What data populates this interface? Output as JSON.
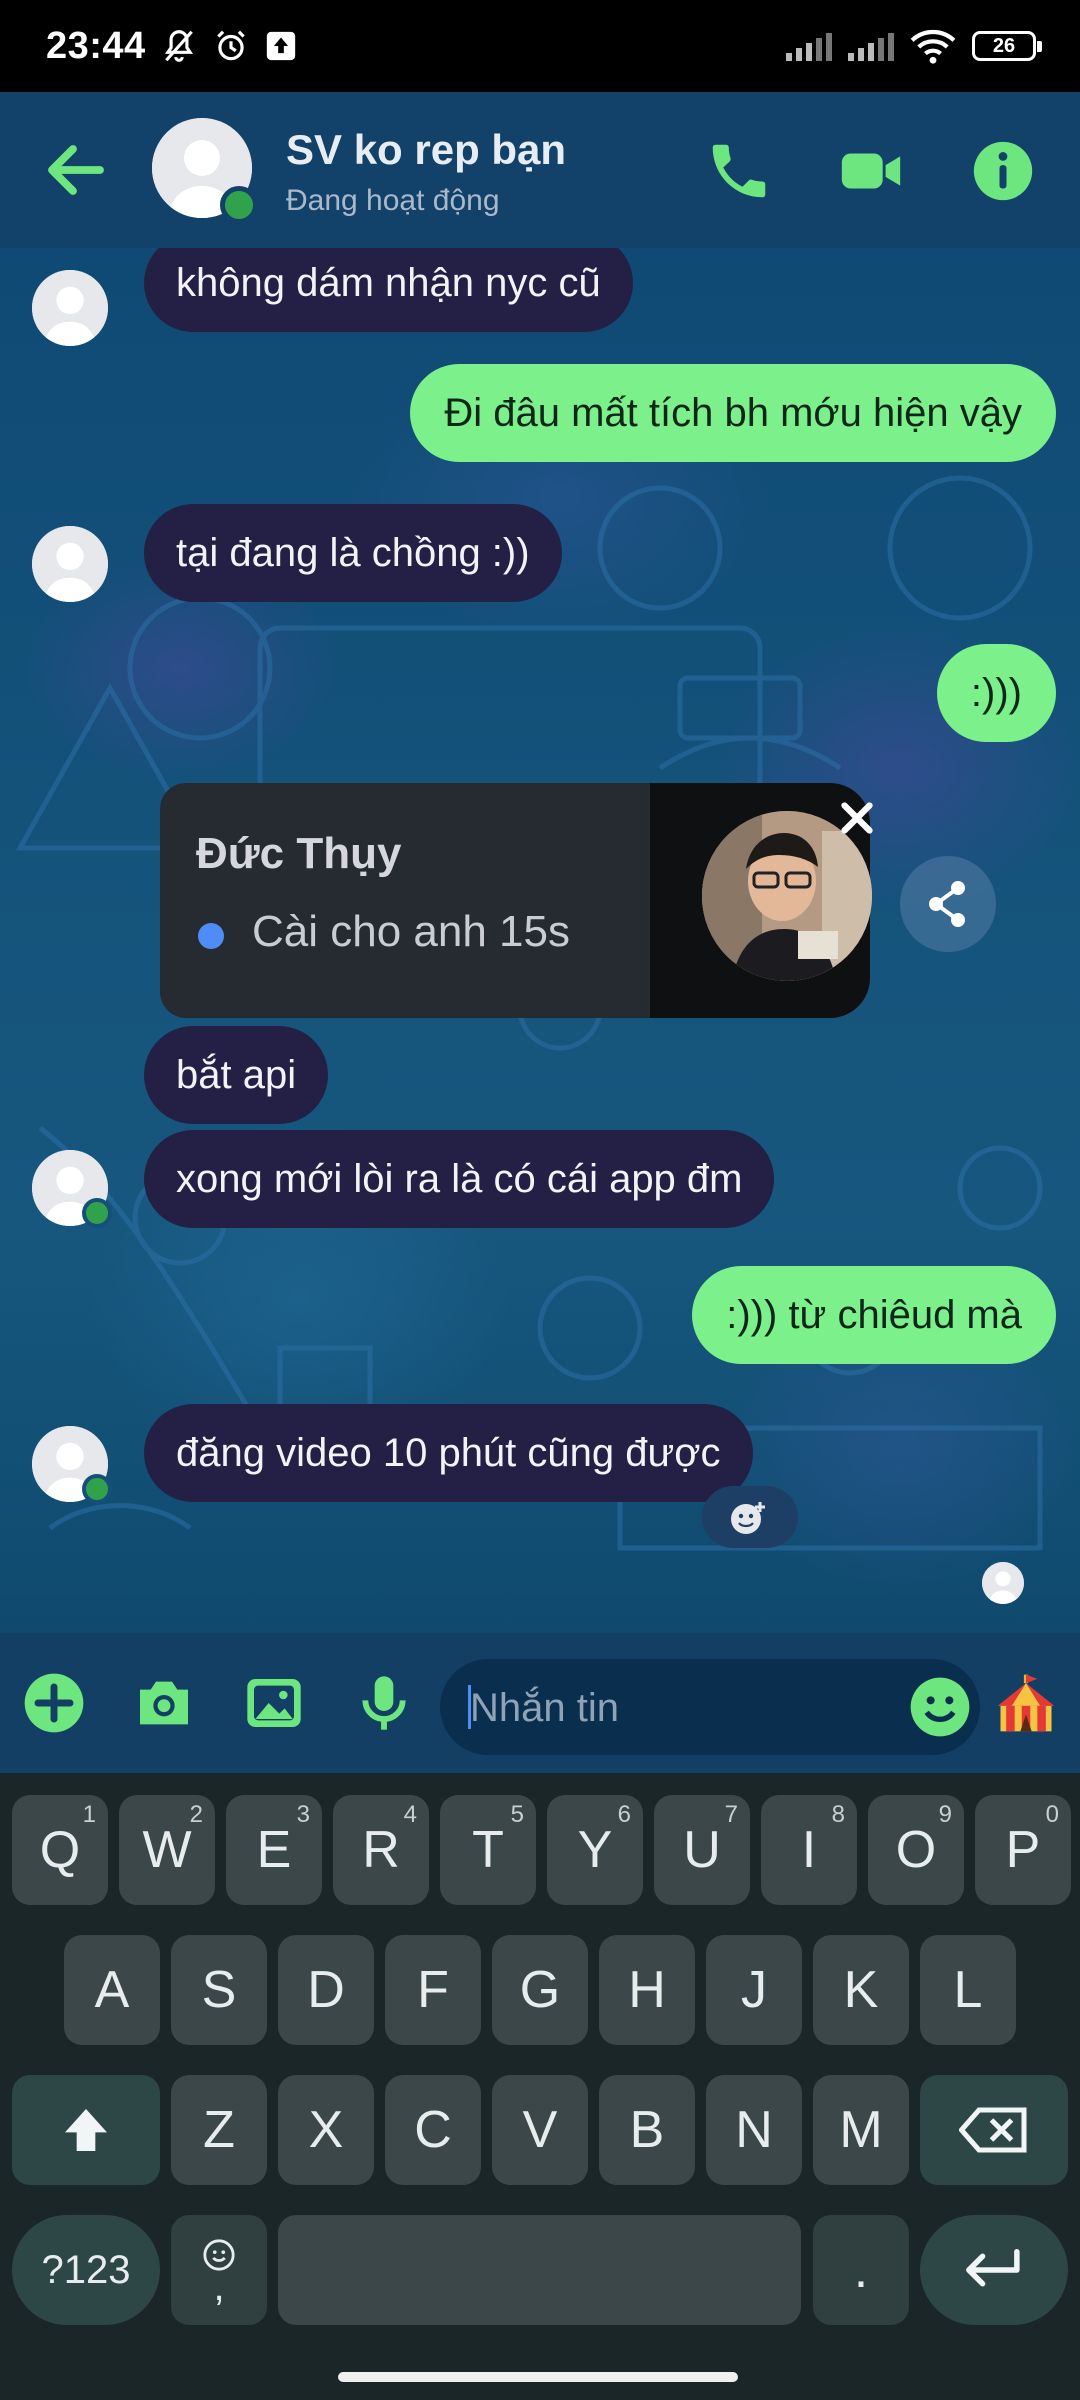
{
  "status_bar": {
    "time": "23:44",
    "battery": "26"
  },
  "header": {
    "title": "SV ko rep bạn",
    "subtitle": "Đang hoạt động"
  },
  "messages": [
    {
      "side": "in",
      "text": "không dám nhận nyc cũ"
    },
    {
      "side": "out",
      "text": "Đi đâu mất tích bh mớu hiện vậy"
    },
    {
      "side": "in",
      "text": "tại đang là chồng :))"
    },
    {
      "side": "out",
      "text": ":)))"
    },
    {
      "side": "in",
      "text": "bắt api"
    },
    {
      "side": "in",
      "text": "xong mới lòi ra là có cái app đm"
    },
    {
      "side": "out",
      "text": ":))) từ chiêud mà"
    },
    {
      "side": "in",
      "text": "đăng video 10 phút cũng được"
    }
  ],
  "notification": {
    "name": "Đức Thụy",
    "message": "Cài cho anh 15s"
  },
  "composer": {
    "placeholder": "Nhắn tin"
  },
  "keyboard": {
    "row1": [
      "Q",
      "W",
      "E",
      "R",
      "T",
      "Y",
      "U",
      "I",
      "O",
      "P"
    ],
    "row1_hints": [
      "1",
      "2",
      "3",
      "4",
      "5",
      "6",
      "7",
      "8",
      "9",
      "0"
    ],
    "row2": [
      "A",
      "S",
      "D",
      "F",
      "G",
      "H",
      "J",
      "K",
      "L"
    ],
    "row3": [
      "Z",
      "X",
      "C",
      "V",
      "B",
      "N",
      "M"
    ],
    "symbols_label": "?123",
    "comma": ",",
    "period": "."
  },
  "colors": {
    "accent": "#6ee67f",
    "incoming_bubble": "#241f45",
    "outgoing_bubble": "#7cf08a",
    "header_bg": "#12426a"
  }
}
